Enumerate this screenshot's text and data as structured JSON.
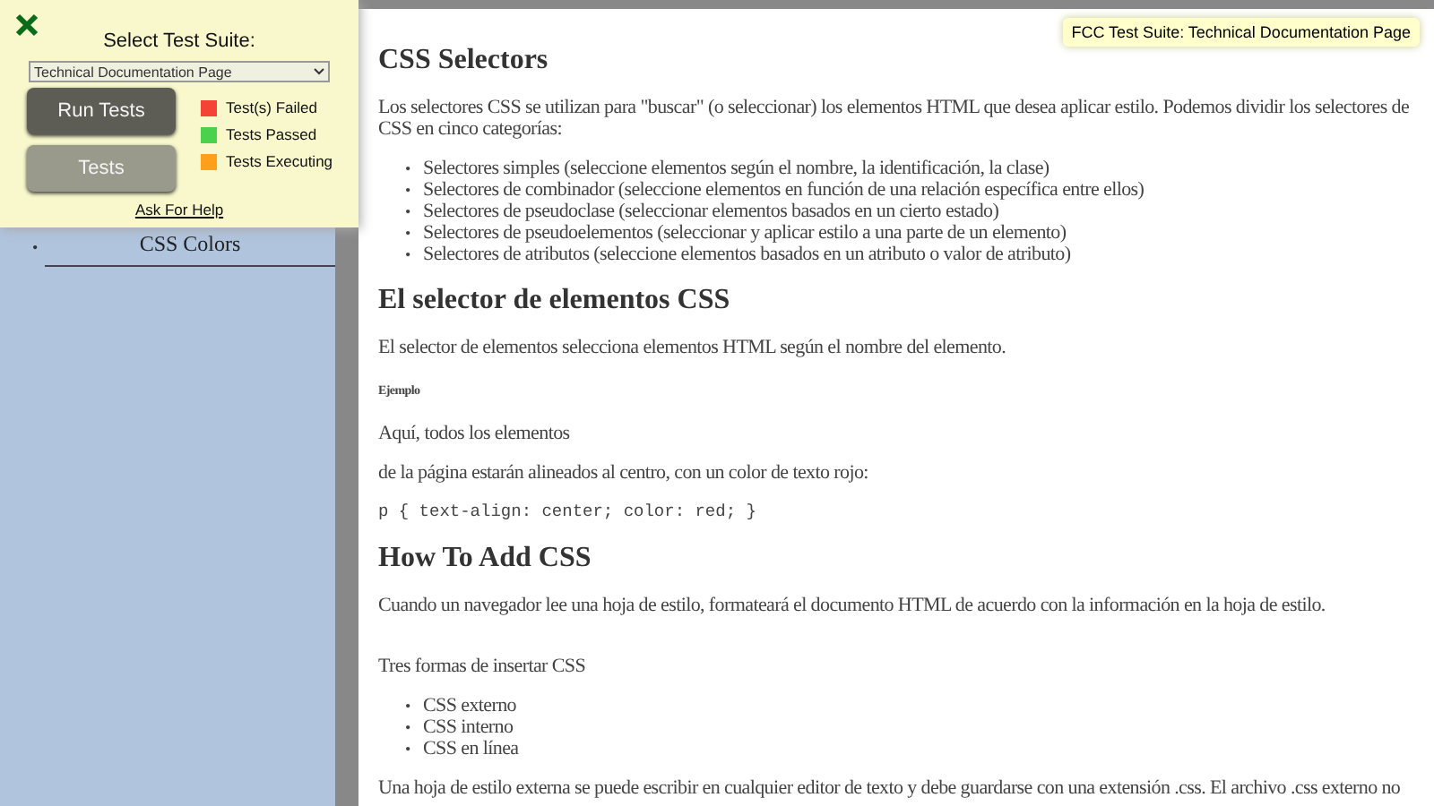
{
  "test_panel": {
    "title": "Select Test Suite:",
    "suite_select": "Technical Documentation Page",
    "run_button": "Run Tests",
    "tests_button": "Tests",
    "legend": [
      {
        "label": "Test(s) Failed",
        "color": "#f44336"
      },
      {
        "label": "Tests Passed",
        "color": "#4cd14c"
      },
      {
        "label": "Tests Executing",
        "color": "#ff9f1a"
      }
    ],
    "help_link": "Ask For Help"
  },
  "sidebar": {
    "marker": "•",
    "items": [
      "CSS Colors"
    ]
  },
  "suite_badge": "FCC Test Suite: Technical Documentation Page",
  "content": [
    {
      "kind": "heading",
      "text": "CSS Selectors"
    },
    {
      "kind": "paragraph",
      "text": "Los selectores CSS se utilizan para \"buscar\" (o seleccionar) los elementos HTML que desea aplicar estilo. Podemos dividir los selectores de CSS en cinco categorías:"
    },
    {
      "kind": "list",
      "marker": "•",
      "items": [
        "Selectores simples (seleccione elementos según el nombre, la identificación, la clase)",
        "Selectores de combinador (seleccione elementos en función de una relación específica entre ellos)",
        "Selectores de pseudoclase (seleccionar elementos basados en un cierto estado)",
        "Selectores de pseudoelementos (seleccionar y aplicar estilo a una parte de un elemento)",
        "Selectores de atributos (seleccione elementos basados en un atributo o valor de atributo)"
      ]
    },
    {
      "kind": "heading",
      "text": "El selector de elementos CSS"
    },
    {
      "kind": "paragraph",
      "text": "El selector de elementos selecciona elementos HTML según el nombre del elemento."
    },
    {
      "kind": "caption",
      "text": "Ejemplo"
    },
    {
      "kind": "paragraph",
      "text": "Aquí, todos los elementos"
    },
    {
      "kind": "paragraph",
      "text": "de la página estarán alineados al centro, con un color de texto rojo:"
    },
    {
      "kind": "code",
      "text": "p { text-align: center; color: red; }"
    },
    {
      "kind": "heading",
      "text": "How To Add CSS"
    },
    {
      "kind": "paragraph",
      "text": "Cuando un navegador lee una hoja de estilo, formateará el documento HTML de acuerdo con la información en la hoja de estilo."
    },
    {
      "kind": "spacer"
    },
    {
      "kind": "paragraph",
      "text": "Tres formas de insertar CSS"
    },
    {
      "kind": "list",
      "marker": "•",
      "items": [
        "CSS externo",
        "CSS interno",
        "CSS en línea"
      ]
    },
    {
      "kind": "paragraph",
      "text": "Una hoja de estilo externa se puede escribir en cualquier editor de texto y debe guardarse con una extensión .css. El archivo .css externo no"
    }
  ]
}
